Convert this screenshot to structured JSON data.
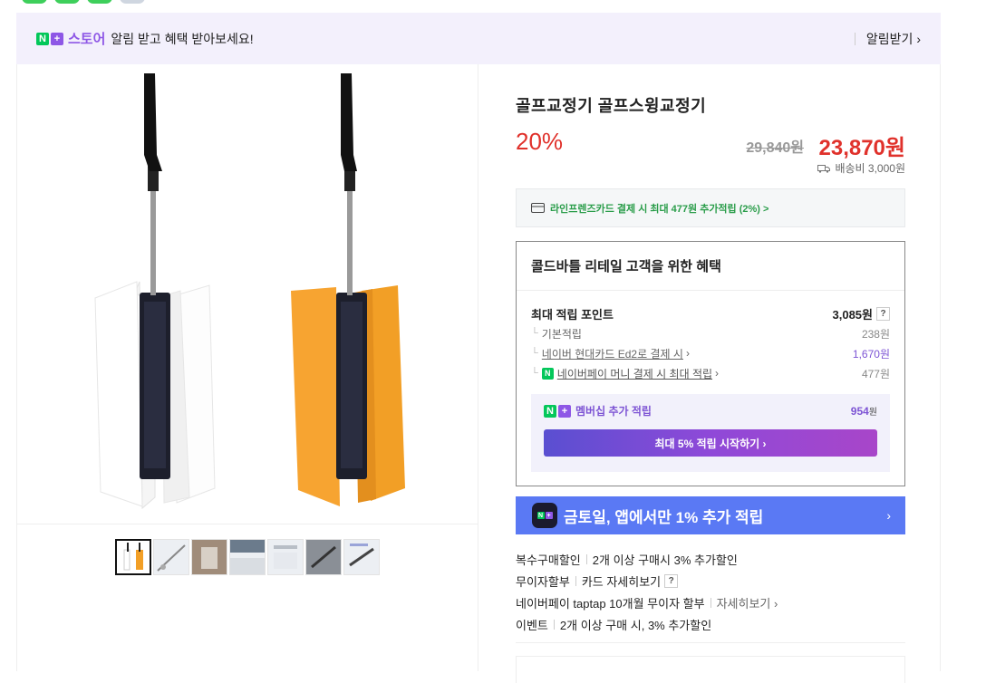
{
  "banner": {
    "logo_n": "N",
    "logo_plus": "+",
    "logo_store": "스토어",
    "message": "알림 받고 혜택 받아보세요!",
    "notify_label": "알림받기 ›"
  },
  "product": {
    "title": "골프교정기 골프스윙교정기",
    "discount": "20%",
    "original_price": "29,840원",
    "sale_price": "23,870원",
    "shipping": "배송비 3,000원"
  },
  "card_offer": "라인프렌즈카드 결제 시 최대 477원 추가적립 (2%) >",
  "benefit": {
    "title": "콜드바틀 리테일 고객을 위한 혜택",
    "max_points_label": "최대 적립 포인트",
    "max_points_value": "3,085원",
    "help_mark": "?",
    "rows": [
      {
        "label": "기본적립",
        "value": "238원"
      },
      {
        "label": "네이버 현대카드 Ed2로 결제 시",
        "value": "1,670원"
      },
      {
        "label": "네이버페이 머니 결제 시 최대 적립",
        "value": "477원"
      }
    ],
    "membership_label": "멤버십 추가 적립",
    "membership_value": "954",
    "membership_unit": "원",
    "membership_button": "최대 5% 적립 시작하기 ›"
  },
  "promo": {
    "text": "금토일, 앱에서만 1% 추가 적립",
    "chevron": "›"
  },
  "extras": [
    {
      "label": "복수구매할인",
      "detail": "2개 이상 구매시 3% 추가할인"
    },
    {
      "label": "무이자할부",
      "detail": "카드 자세히보기",
      "help": "?"
    },
    {
      "label": "네이버페이 taptap 10개월 무이자 할부",
      "detail": "자세히보기 ›"
    },
    {
      "label": "이벤트",
      "detail": "2개 이상 구매 시, 3% 추가할인"
    }
  ],
  "colors": {
    "accent_red": "#e0312b",
    "naver_green": "#03c75a",
    "plus_purple": "#8e57e6",
    "promo_blue": "#5a79f4"
  }
}
